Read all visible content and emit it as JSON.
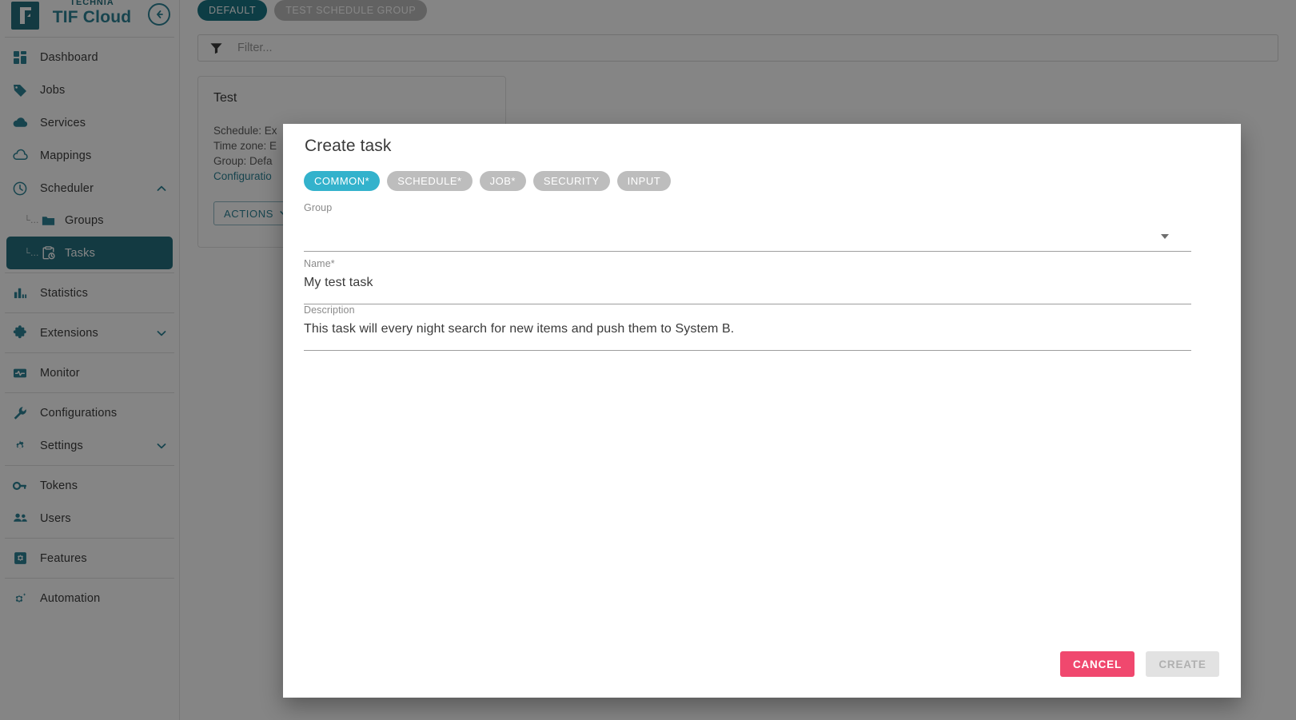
{
  "brand": {
    "company": "TECHNIA",
    "product": "TIF Cloud",
    "collapse_icon": "arrow-left-circle-icon",
    "logo_icon": "technia-flag-logo-icon"
  },
  "sidebar": {
    "items": [
      {
        "label": "Dashboard",
        "icon": "dashboard-grid-icon",
        "state": "normal"
      },
      {
        "label": "Jobs",
        "icon": "tag-icon",
        "state": "normal"
      },
      {
        "label": "Services",
        "icon": "cloud-filled-icon",
        "state": "normal"
      },
      {
        "label": "Mappings",
        "icon": "cloud-outline-icon",
        "state": "normal"
      },
      {
        "label": "Scheduler",
        "icon": "clock-icon",
        "state": "expanded",
        "chevron": "chevron-up-icon"
      },
      {
        "label": "Groups",
        "icon": "folder-icon",
        "state": "sub"
      },
      {
        "label": "Tasks",
        "icon": "clipboard-clock-icon",
        "state": "sub-active"
      },
      {
        "label": "Statistics",
        "icon": "bar-chart-icon",
        "state": "normal"
      },
      {
        "label": "Extensions",
        "icon": "puzzle-icon",
        "state": "collapsed",
        "chevron": "chevron-down-icon"
      },
      {
        "label": "Monitor",
        "icon": "monitor-pulse-icon",
        "state": "normal"
      },
      {
        "label": "Configurations",
        "icon": "wrench-icon",
        "state": "normal"
      },
      {
        "label": "Settings",
        "icon": "gear-icon",
        "state": "collapsed",
        "chevron": "chevron-down-icon"
      },
      {
        "label": "Tokens",
        "icon": "key-icon",
        "state": "normal"
      },
      {
        "label": "Users",
        "icon": "users-icon",
        "state": "normal"
      },
      {
        "label": "Features",
        "icon": "feature-gear-square-icon",
        "state": "normal"
      },
      {
        "label": "Automation",
        "icon": "gear-sparkle-icon",
        "state": "normal"
      }
    ]
  },
  "main": {
    "group_chips": [
      {
        "label": "DEFAULT",
        "selected": true
      },
      {
        "label": "TEST SCHEDULE GROUP",
        "selected": false
      }
    ],
    "filter": {
      "placeholder": "Filter...",
      "value": "",
      "icon": "funnel-filter-icon"
    },
    "task_card": {
      "title": "Test",
      "schedule": "Schedule: Ex",
      "time_zone": "Time zone: E",
      "group": "Group: Defa",
      "configuration_link": "Configuratio",
      "actions_label": "ACTIONS",
      "actions_icon": "chevron-down-icon"
    }
  },
  "dialog": {
    "title": "Create task",
    "tabs": [
      {
        "label": "COMMON*",
        "selected": true
      },
      {
        "label": "SCHEDULE*",
        "selected": false
      },
      {
        "label": "JOB*",
        "selected": false
      },
      {
        "label": "SECURITY",
        "selected": false
      },
      {
        "label": "INPUT",
        "selected": false
      }
    ],
    "fields": {
      "group": {
        "label": "Group",
        "value": "",
        "dropdown_icon": "chevron-down-caret-icon"
      },
      "name": {
        "label": "Name",
        "required_marker": "*",
        "value": "My test task"
      },
      "description": {
        "label": "Description",
        "value": "This task will every night search for new items and push them to System B."
      }
    },
    "footer": {
      "cancel_label": "CANCEL",
      "create_label": "CREATE",
      "create_disabled": true
    }
  },
  "colors": {
    "brand_teal": "#2c8396",
    "active_nav": "#25707f",
    "tab_active": "#33b2cc",
    "tab_inactive": "#bdbdbd",
    "cancel_pink": "#f0486e",
    "chip_selected": "#1a7585"
  }
}
